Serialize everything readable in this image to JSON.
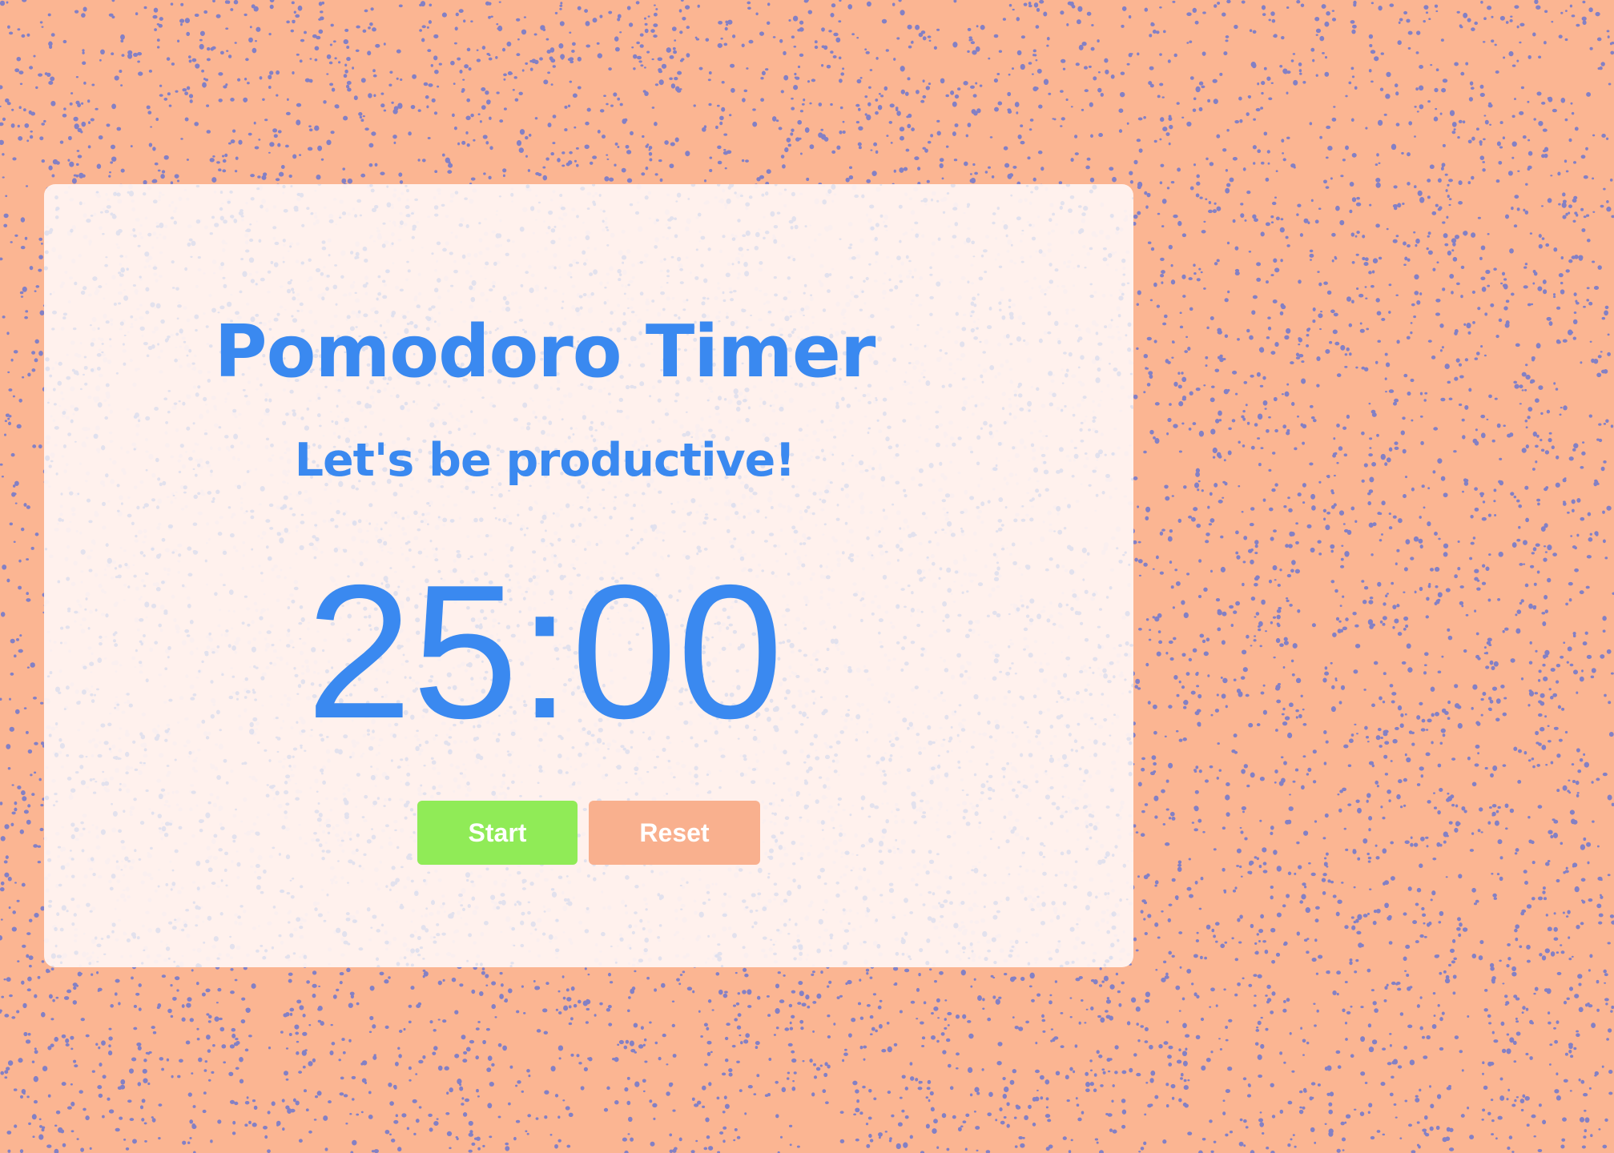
{
  "app": {
    "title": "Pomodoro Timer",
    "subtitle": "Let's be productive!"
  },
  "timer": {
    "display": "25:00",
    "minutes": 25,
    "seconds": 0
  },
  "controls": {
    "start_label": "Start",
    "reset_label": "Reset"
  },
  "colors": {
    "background": "#fbb592",
    "speckle": "#6f77cf",
    "card": "#fff4f0",
    "accent_blue": "#3a89f0",
    "start_button": "#90eb57",
    "reset_button": "#f9b08e",
    "button_text": "#ffffff"
  }
}
